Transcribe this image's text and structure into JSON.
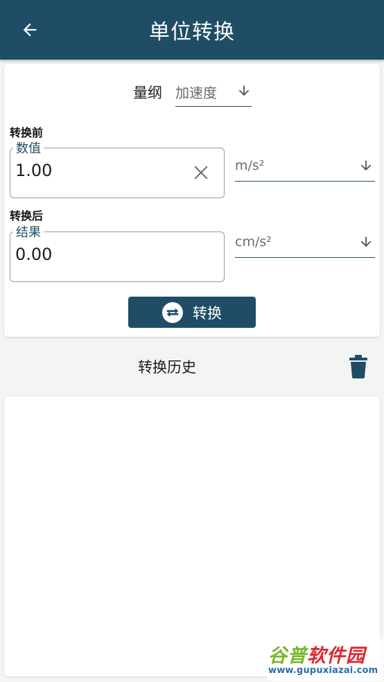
{
  "appbar": {
    "title": "单位转换",
    "back_icon": "arrow-left-icon"
  },
  "dimension": {
    "label": "量纲",
    "value": "加速度"
  },
  "before": {
    "section_label": "转换前",
    "field_legend": "数值",
    "value": "1.00",
    "unit": "m/s²"
  },
  "after": {
    "section_label": "转换后",
    "field_legend": "结果",
    "value": "0.00",
    "unit": "cm/s²"
  },
  "convert_button": {
    "label": "转换",
    "icon": "swap-icon"
  },
  "history": {
    "title": "转换历史",
    "delete_icon": "trash-icon",
    "items": []
  },
  "watermark": {
    "brand_part1": "谷普",
    "brand_part2": "软件园",
    "url": "www.gupuxiazai.com"
  },
  "colors": {
    "primary": "#1f4d66",
    "background": "#f4f4f4",
    "card": "#ffffff",
    "field_border": "#9a9a9a",
    "muted_text": "#6b6b6b"
  }
}
